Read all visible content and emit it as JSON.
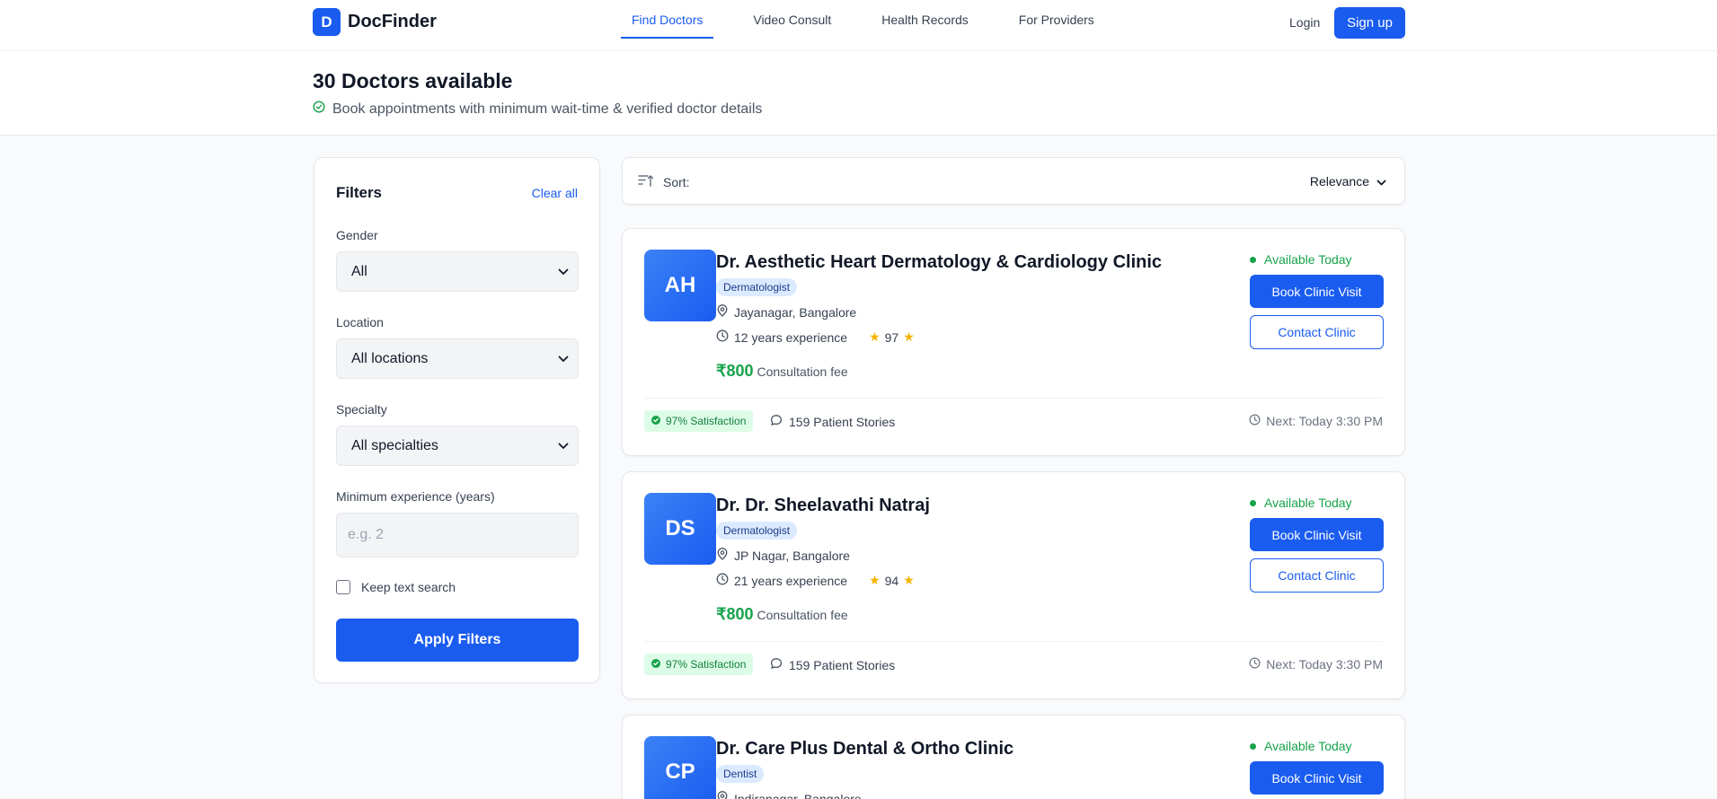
{
  "brand": {
    "logo_letter": "D",
    "name": "DocFinder",
    "accent": "#1a5cf0"
  },
  "nav": {
    "items": [
      {
        "label": "Find Doctors",
        "active": true
      },
      {
        "label": "Video Consult",
        "active": false
      },
      {
        "label": "Health Records",
        "active": false
      },
      {
        "label": "For Providers",
        "active": false
      }
    ],
    "login": "Login",
    "signup": "Sign up"
  },
  "hero": {
    "title": "30 Doctors available",
    "subtitle": "Book appointments with minimum wait-time & verified doctor details"
  },
  "filters": {
    "title": "Filters",
    "clear": "Clear all",
    "gender": {
      "label": "Gender",
      "value": "All"
    },
    "location": {
      "label": "Location",
      "value": "All locations"
    },
    "specialty": {
      "label": "Specialty",
      "value": "All specialties"
    },
    "experience": {
      "label": "Minimum experience (years)",
      "placeholder": "e.g. 2",
      "value": ""
    },
    "keep_text": {
      "label": "Keep text search",
      "checked": false
    },
    "apply": "Apply Filters"
  },
  "sort": {
    "label": "Sort:",
    "value": "Relevance"
  },
  "doctors": [
    {
      "initials": "AH",
      "name": "Dr. Aesthetic Heart Dermatology & Cardiology Clinic",
      "specialty": "Dermatologist",
      "location": "Jayanagar, Bangalore",
      "experience": "12 years experience",
      "rating": "97",
      "fee": "₹800",
      "fee_label": "Consultation fee",
      "availability": "Available Today",
      "book": "Book Clinic Visit",
      "contact": "Contact Clinic",
      "satisfaction": "97% Satisfaction",
      "stories": "159 Patient Stories",
      "next": "Next: Today 3:30 PM"
    },
    {
      "initials": "DS",
      "name": "Dr. Dr. Sheelavathi Natraj",
      "specialty": "Dermatologist",
      "location": "JP Nagar, Bangalore",
      "experience": "21 years experience",
      "rating": "94",
      "fee": "₹800",
      "fee_label": "Consultation fee",
      "availability": "Available Today",
      "book": "Book Clinic Visit",
      "contact": "Contact Clinic",
      "satisfaction": "97% Satisfaction",
      "stories": "159 Patient Stories",
      "next": "Next: Today 3:30 PM"
    },
    {
      "initials": "CP",
      "name": "Dr. Care Plus Dental & Ortho Clinic",
      "specialty": "Dentist",
      "location": "Indiranagar, Bangalore",
      "availability": "Available Today",
      "book": "Book Clinic Visit"
    }
  ]
}
